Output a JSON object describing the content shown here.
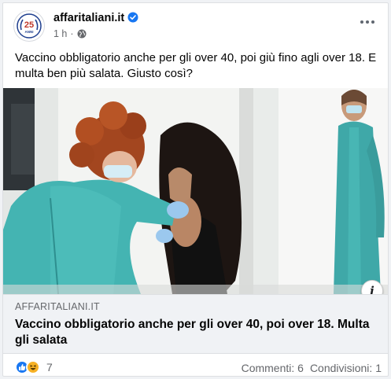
{
  "post": {
    "page_name": "affaritaliani.it",
    "avatar_text": "25",
    "avatar_subtext": "ANNI",
    "time": "1 h",
    "separator": "·",
    "text": "Vaccino obbligatorio anche per gli over 40, poi giù fino agli over 18. E multa ben più salata. Giusto così?"
  },
  "link": {
    "domain": "AFFARITALIANI.IT",
    "title": "Vaccino obbligatorio anche per gli over 40, poi over 18. Multa gli salata",
    "info_icon": "i"
  },
  "footer": {
    "reaction_count": "7",
    "comments": "Commenti: 6",
    "shares": "Condivisioni: 1"
  },
  "icons": {
    "verified": "verified-badge-icon",
    "privacy": "globe-icon",
    "more": "more-options-icon",
    "reactions": [
      "like-icon",
      "haha-icon"
    ]
  },
  "colors": {
    "brand_blue": "#1877f2",
    "secondary_text": "#65676b",
    "link_bg": "#f0f2f5",
    "haha_yellow": "#f7b125"
  }
}
